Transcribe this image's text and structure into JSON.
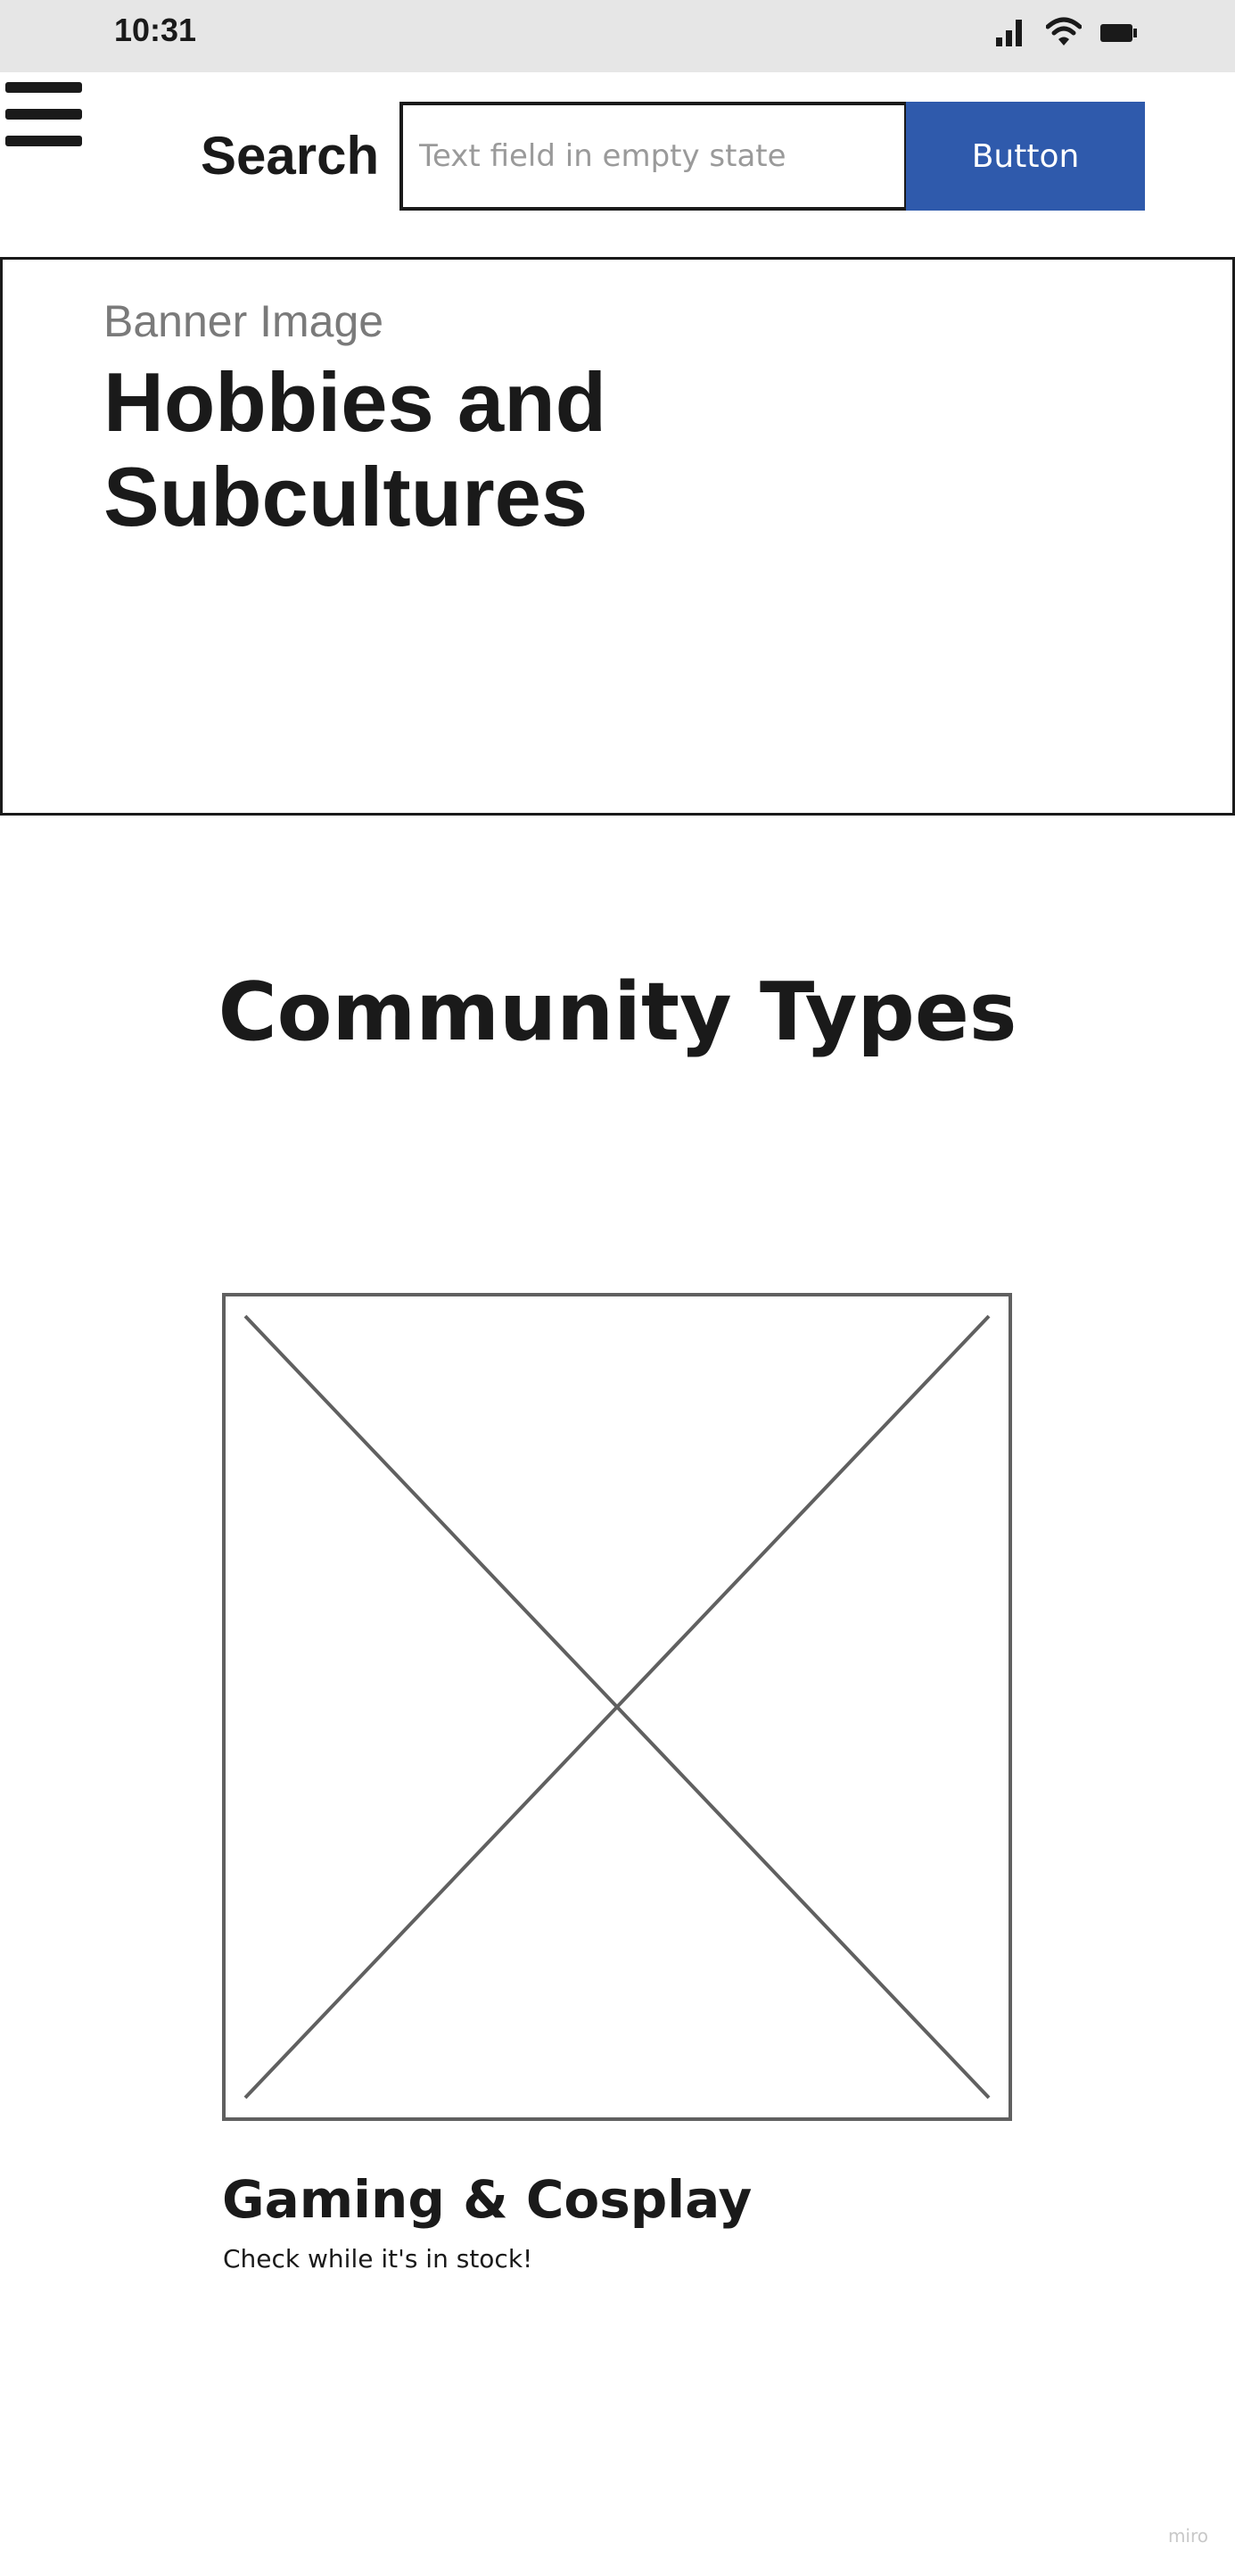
{
  "status_bar": {
    "time": "10:31",
    "icons": [
      "signal-icon",
      "wifi-icon",
      "battery-icon"
    ]
  },
  "header": {
    "menu_icon": "hamburger-menu-icon",
    "search_label": "Search",
    "search_placeholder": "Text field in empty state",
    "search_value": "",
    "button_label": "Button"
  },
  "banner": {
    "caption": "Banner Image",
    "title": "Hobbies and Subcultures"
  },
  "section": {
    "title": "Community Types"
  },
  "card": {
    "image_icon": "image-placeholder-icon",
    "title": "Gaming & Cosplay",
    "subtitle": "Check while it's in stock!"
  },
  "watermark": "miro",
  "colors": {
    "status_bar_bg": "#e6e6e6",
    "button_bg": "#2f5aac",
    "button_text": "#ffffff",
    "text_primary": "#1a1a1a",
    "text_muted": "#7a7a7a",
    "placeholder_text": "#9a9a9a",
    "image_stroke": "#606060"
  }
}
